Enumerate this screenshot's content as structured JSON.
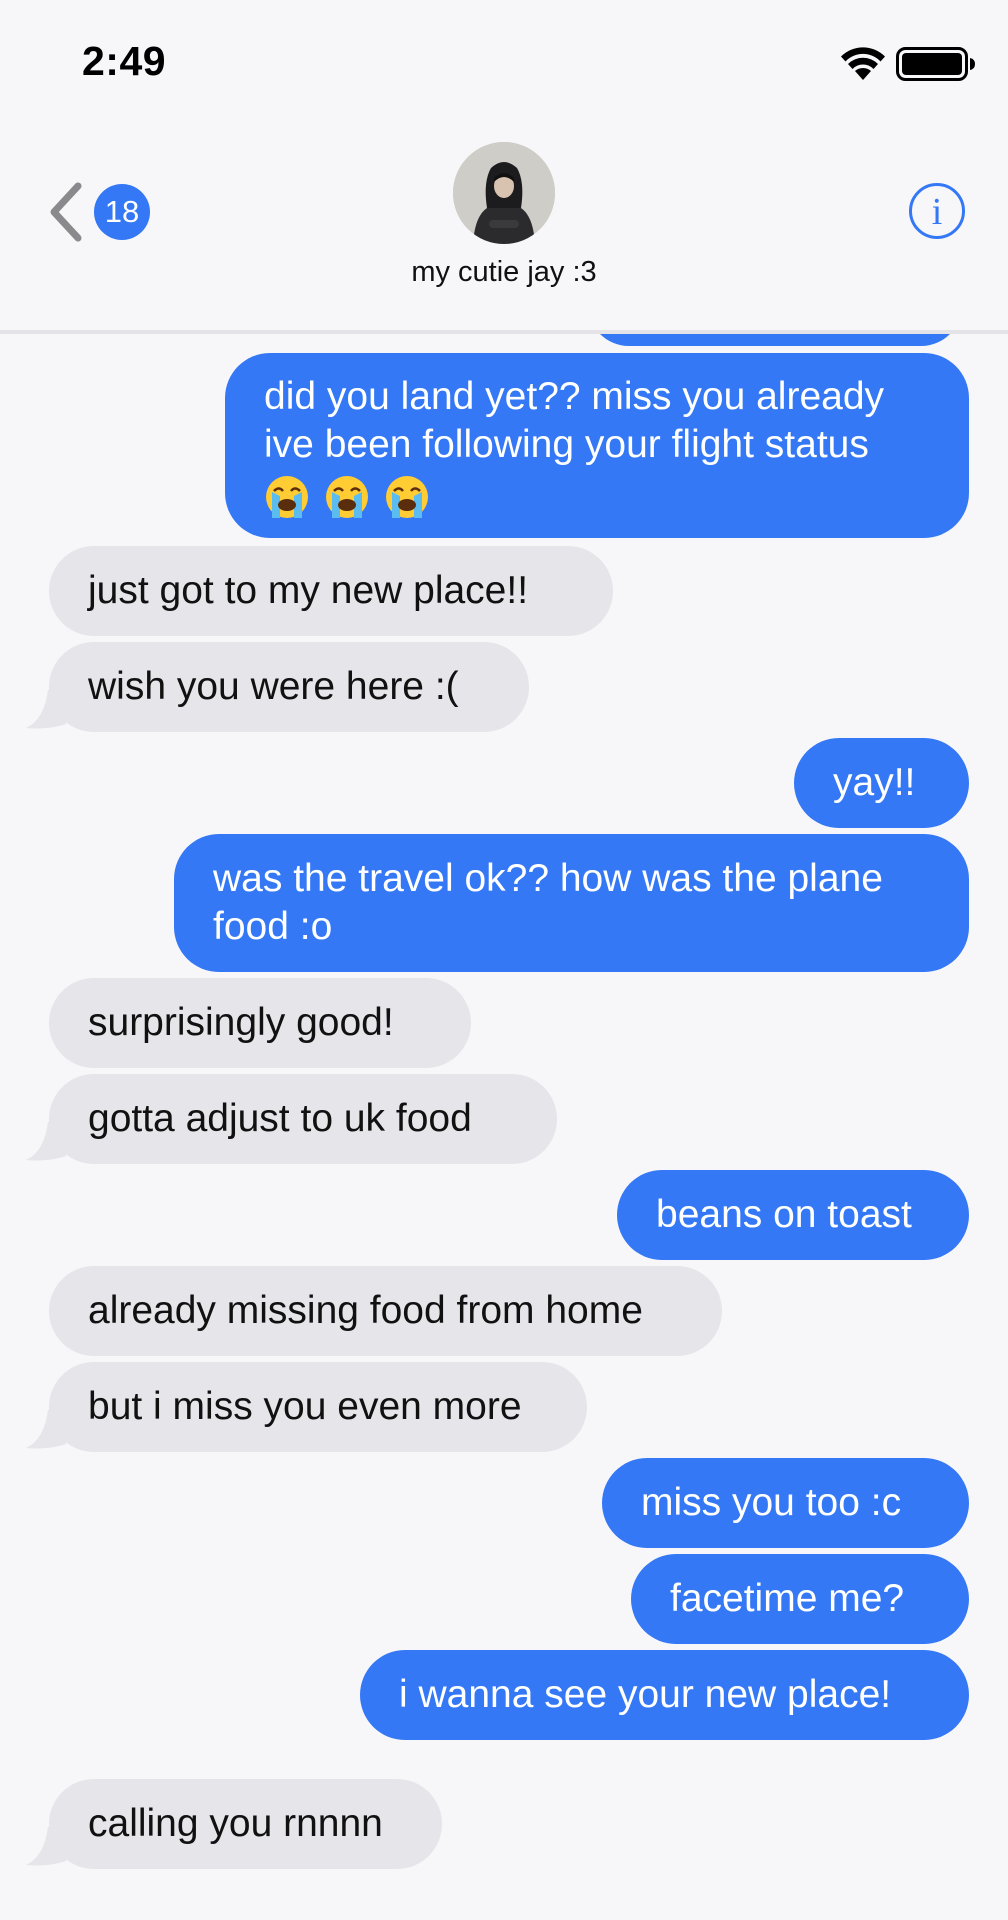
{
  "status_bar": {
    "time": "2:49",
    "icons": [
      "wifi-icon",
      "battery-icon"
    ]
  },
  "header": {
    "back_badge": "18",
    "contact_name": "my cutie jay :3",
    "icons": [
      "chevron-left-icon",
      "info-icon"
    ]
  },
  "colors": {
    "sent": "#3478f6",
    "received": "#e5e5ea",
    "background": "#f7f7f9"
  },
  "messages": [
    {
      "from": "me",
      "lines": [
        "did you land yet?? miss you already",
        "ive been following your flight status"
      ],
      "emoji": [
        "loudly-crying-face-emoji",
        "loudly-crying-face-emoji",
        "loudly-crying-face-emoji"
      ]
    },
    {
      "from": "them",
      "text": "just got to my new place!!"
    },
    {
      "from": "them",
      "text": "wish you were here :("
    },
    {
      "from": "me",
      "text": "yay!!"
    },
    {
      "from": "me",
      "lines": [
        "was the travel ok?? how was the plane",
        "food :o"
      ]
    },
    {
      "from": "them",
      "text": "surprisingly good!"
    },
    {
      "from": "them",
      "text": "gotta adjust to uk food"
    },
    {
      "from": "me",
      "text": "beans on toast"
    },
    {
      "from": "them",
      "text": "already missing food from home"
    },
    {
      "from": "them",
      "text": "but i miss you even more"
    },
    {
      "from": "me",
      "text": "miss you too :c"
    },
    {
      "from": "me",
      "text": "facetime me?"
    },
    {
      "from": "me",
      "text": "i wanna see your new place!"
    },
    {
      "from": "them",
      "text": "calling you rnnnn"
    }
  ]
}
